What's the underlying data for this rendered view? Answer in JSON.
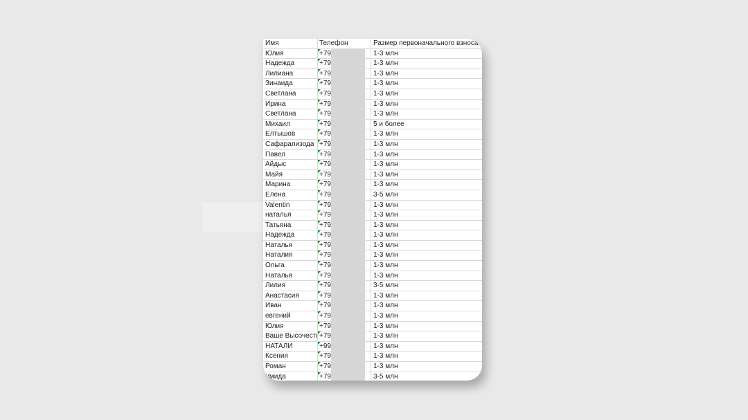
{
  "columns": {
    "name": "Имя",
    "phone": "Телефон",
    "amount": "Размер первоначального взноса"
  },
  "rows": [
    {
      "name": "Юлия",
      "phone": "+79",
      "amount": "1-3 млн"
    },
    {
      "name": "Надежда",
      "phone": "+79",
      "amount": "1-3 млн"
    },
    {
      "name": "Лилиана",
      "phone": "+79",
      "amount": "1-3 млн"
    },
    {
      "name": "Зинаида",
      "phone": "+79",
      "amount": "1-3 млн"
    },
    {
      "name": "Светлана",
      "phone": "+79",
      "amount": "1-3 млн"
    },
    {
      "name": "Ирина",
      "phone": "+79",
      "amount": "1-3 млн"
    },
    {
      "name": "Светлана",
      "phone": "+79",
      "amount": "1-3 млн"
    },
    {
      "name": "Михаил",
      "phone": "+79",
      "amount": "5 и более"
    },
    {
      "name": "Елтышов",
      "phone": "+79",
      "amount": "1-3 млн"
    },
    {
      "name": "Сафарализода",
      "phone": "+79",
      "amount": "1-3 млн"
    },
    {
      "name": "Павел",
      "phone": "+79",
      "amount": "1-3 млн"
    },
    {
      "name": "Айдыс",
      "phone": "+79",
      "amount": "1-3 млн"
    },
    {
      "name": "Майя",
      "phone": "+79",
      "amount": "1-3 млн"
    },
    {
      "name": "Марина",
      "phone": "+79",
      "amount": "1-3 млн"
    },
    {
      "name": "Елена",
      "phone": "+79",
      "amount": "3-5 млн"
    },
    {
      "name": "Valentin",
      "phone": "+79",
      "amount": "1-3 млн"
    },
    {
      "name": "наталья",
      "phone": "+79",
      "amount": "1-3 млн"
    },
    {
      "name": "Татьяна",
      "phone": "+79",
      "amount": "1-3 млн"
    },
    {
      "name": "Надежда",
      "phone": "+79",
      "amount": "1-3 млн"
    },
    {
      "name": "Наталья",
      "phone": "+79",
      "amount": "1-3 млн"
    },
    {
      "name": "Наталия",
      "phone": "+79",
      "amount": "1-3 млн"
    },
    {
      "name": "Ольга",
      "phone": "+79",
      "amount": "1-3 млн"
    },
    {
      "name": "Наталья",
      "phone": "+79",
      "amount": "1-3 млн"
    },
    {
      "name": "Лилия",
      "phone": "+79",
      "amount": "3-5 млн"
    },
    {
      "name": "Анастасия",
      "phone": "+79",
      "amount": "1-3 млн"
    },
    {
      "name": "Иван",
      "phone": "+79",
      "amount": "1-3 млн"
    },
    {
      "name": "евгений",
      "phone": "+79",
      "amount": "1-3 млн"
    },
    {
      "name": "Юлия",
      "phone": "+79",
      "amount": "1-3 млн"
    },
    {
      "name": "Ваше Высочество",
      "phone": "+79",
      "amount": "1-3 млн"
    },
    {
      "name": "НАТАЛИ",
      "phone": "+99",
      "amount": "1-3 млн"
    },
    {
      "name": "Ксения",
      "phone": "+79",
      "amount": "1-3 млн"
    },
    {
      "name": "Роман",
      "phone": "+79",
      "amount": "1-3 млн"
    },
    {
      "name": "Умида",
      "phone": "+79",
      "amount": "3-5 млн"
    }
  ]
}
